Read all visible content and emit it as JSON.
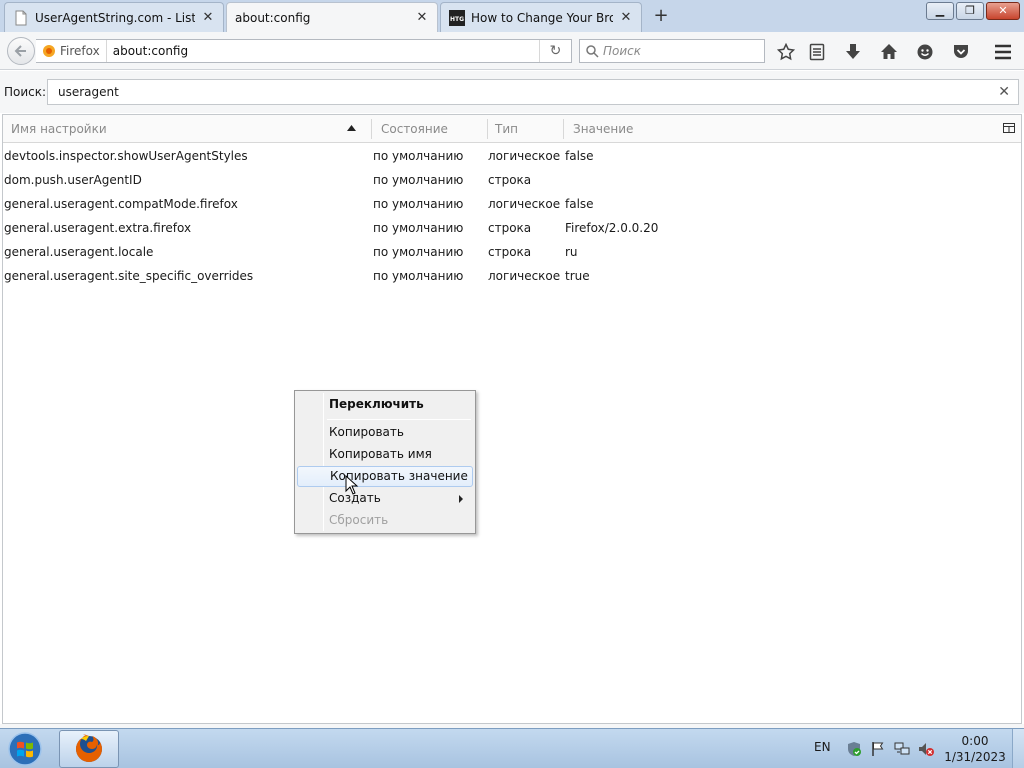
{
  "browser": {
    "tabs": [
      {
        "label": "UserAgentString.com - List of F...",
        "favicon": "blank-page-icon",
        "active": false
      },
      {
        "label": "about:config",
        "favicon": "none",
        "active": true
      },
      {
        "label": "How to Change Your Brow...",
        "favicon": "htg-site-icon",
        "favicon_text": "HTG",
        "active": false
      }
    ],
    "new_tab_label": "+",
    "window_buttons": {
      "minimize": "minimize-icon",
      "maximize": "maximize-icon",
      "close": "close-icon"
    },
    "identity_label": "Firefox",
    "url": "about:config",
    "search_placeholder": "Поиск",
    "toolbar_icons": [
      "bookmark-star-icon",
      "reading-list-icon",
      "download-icon",
      "home-icon",
      "hello-icon",
      "pocket-icon",
      "hamburger-menu-icon"
    ],
    "accent_color": "#e66000"
  },
  "config": {
    "search_label": "Поиск:",
    "search_value": "useragent",
    "columns": {
      "name": "Имя настройки",
      "state": "Состояние",
      "type": "Тип",
      "value": "Значение"
    },
    "sort": "name-ascending",
    "rows": [
      {
        "name": "devtools.inspector.showUserAgentStyles",
        "state": "по умолчанию",
        "type": "логическое",
        "value": "false"
      },
      {
        "name": "dom.push.userAgentID",
        "state": "по умолчанию",
        "type": "строка",
        "value": ""
      },
      {
        "name": "general.useragent.compatMode.firefox",
        "state": "по умолчанию",
        "type": "логическое",
        "value": "false"
      },
      {
        "name": "general.useragent.extra.firefox",
        "state": "по умолчанию",
        "type": "строка",
        "value": "Firefox/2.0.0.20"
      },
      {
        "name": "general.useragent.locale",
        "state": "по умолчанию",
        "type": "строка",
        "value": "ru"
      },
      {
        "name": "general.useragent.site_specific_overrides",
        "state": "по умолчанию",
        "type": "логическое",
        "value": "true"
      }
    ]
  },
  "context_menu": {
    "items": [
      {
        "label": "Переключить",
        "bold": true
      },
      {
        "label": "Копировать"
      },
      {
        "label": "Копировать имя"
      },
      {
        "label": "Копировать значение",
        "hover": true
      },
      {
        "label": "Создать",
        "submenu": true
      },
      {
        "label": "Сбросить",
        "disabled": true
      }
    ]
  },
  "taskbar": {
    "pinned": [
      "windows-start-icon",
      "firefox-icon"
    ],
    "language": "EN",
    "tray_icons": [
      "security-shield-icon",
      "action-center-flag-icon",
      "network-icon",
      "volume-muted-icon"
    ],
    "time": "0:00",
    "date": "1/31/2023"
  }
}
